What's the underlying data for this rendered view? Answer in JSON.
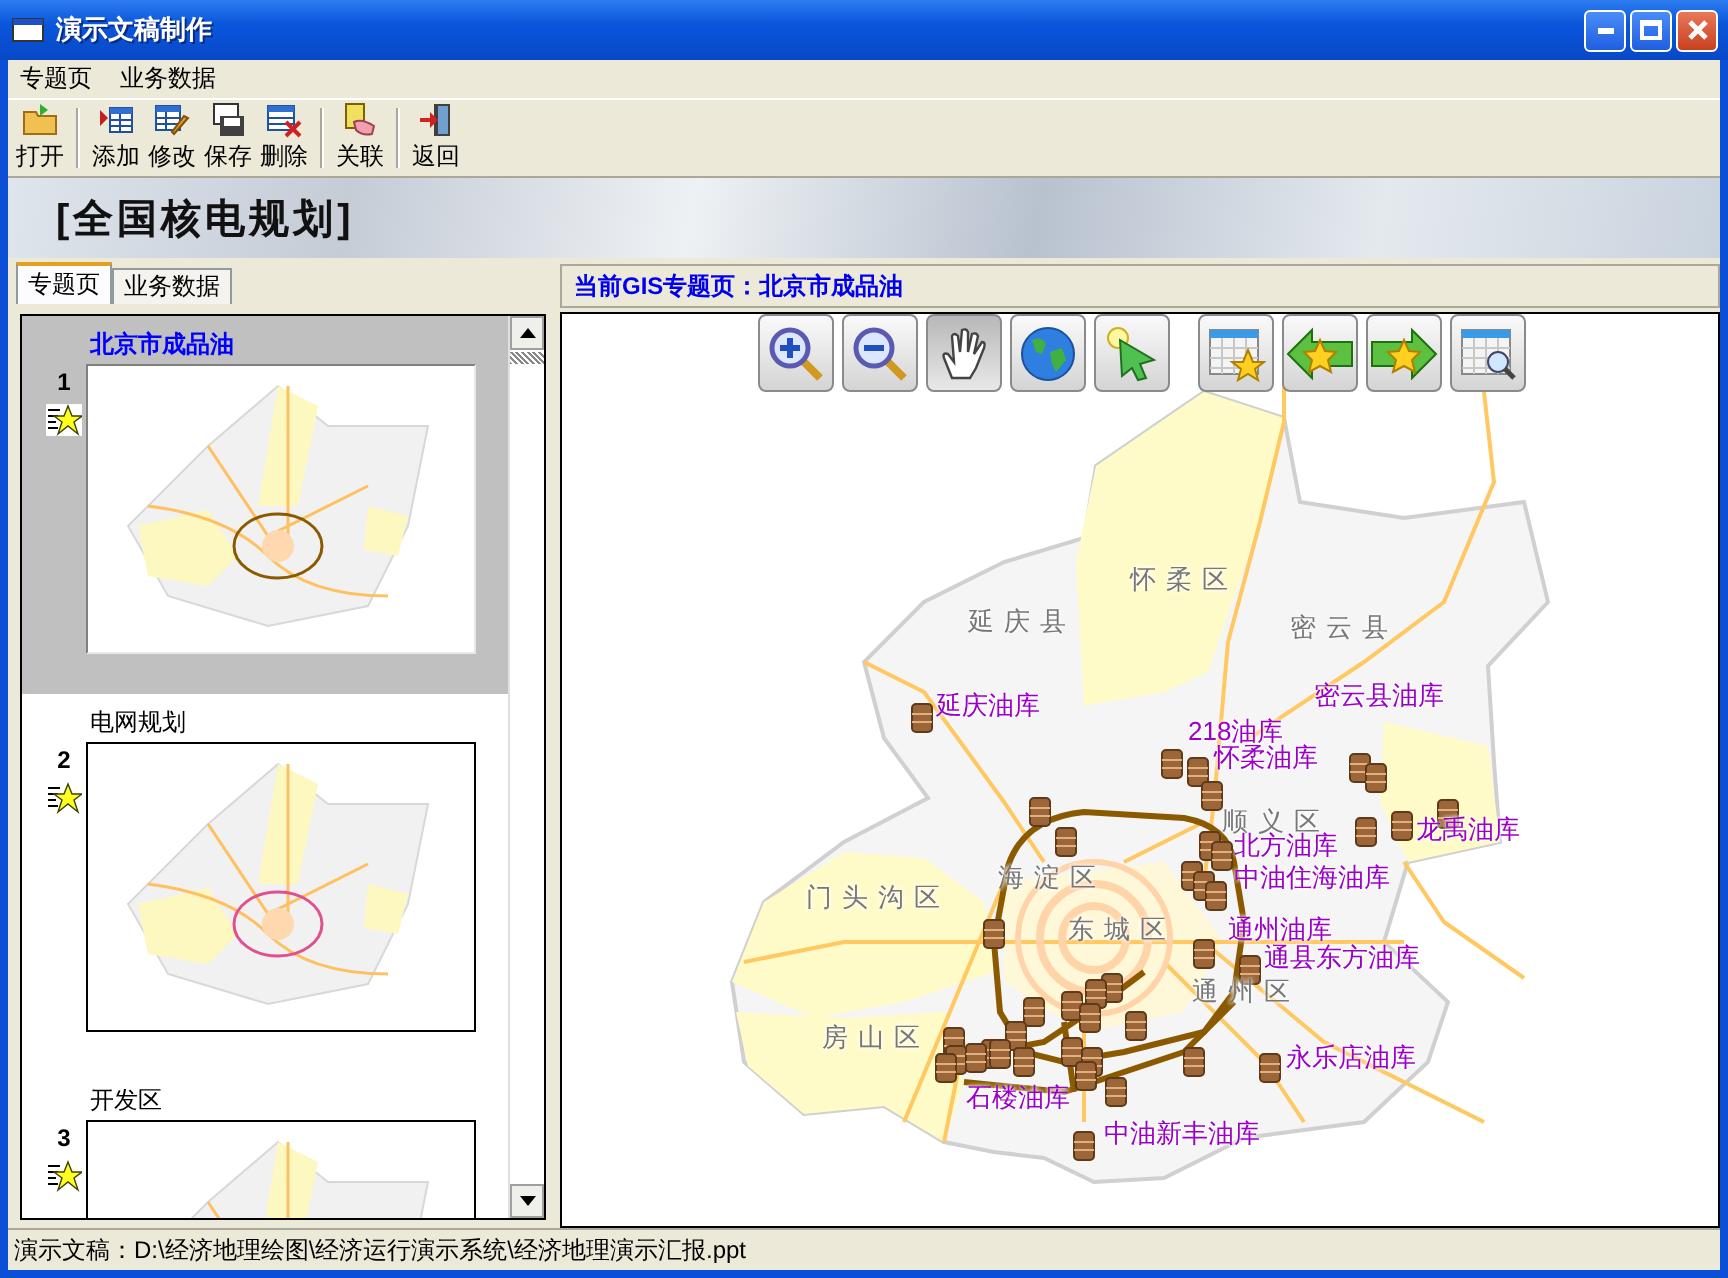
{
  "window": {
    "title": "演示文稿制作"
  },
  "menu": [
    "专题页",
    "业务数据"
  ],
  "toolbar_groups": [
    {
      "buttons": [
        {
          "kind": "open",
          "label": "打开"
        }
      ]
    },
    {
      "buttons": [
        {
          "kind": "add",
          "label": "添加"
        },
        {
          "kind": "edit",
          "label": "修改"
        },
        {
          "kind": "save",
          "label": "保存"
        },
        {
          "kind": "delete",
          "label": "删除"
        }
      ]
    },
    {
      "buttons": [
        {
          "kind": "link",
          "label": "关联"
        }
      ]
    },
    {
      "buttons": [
        {
          "kind": "exit",
          "label": "返回"
        }
      ]
    }
  ],
  "banner": {
    "title": "[全国核电规划]"
  },
  "side_tabs": [
    {
      "label": "专题页",
      "selected": true
    },
    {
      "label": "业务数据",
      "selected": false
    }
  ],
  "slides": [
    {
      "number": "1",
      "title": "北京市成品油",
      "selected": true
    },
    {
      "number": "2",
      "title": "电网规划",
      "selected": false
    },
    {
      "number": "3",
      "title": "开发区",
      "selected": false
    }
  ],
  "gis_header": "当前GIS专题页：北京市成品油",
  "map_tools": [
    {
      "kind": "zoom_in",
      "selected": false
    },
    {
      "kind": "zoom_out",
      "selected": false
    },
    {
      "kind": "pan",
      "selected": true
    },
    {
      "kind": "globe",
      "selected": false
    },
    {
      "kind": "select",
      "selected": false
    },
    {
      "kind": "slide_star",
      "selected": false
    },
    {
      "kind": "prev",
      "selected": false
    },
    {
      "kind": "next",
      "selected": false
    },
    {
      "kind": "grid_search",
      "selected": false
    }
  ],
  "map_labels": [
    {
      "kind": "district",
      "text": "怀柔区"
    },
    {
      "kind": "district",
      "text": "延庆县"
    },
    {
      "kind": "district",
      "text": "密云县"
    },
    {
      "kind": "district",
      "text": "顺义区"
    },
    {
      "kind": "district",
      "text": "门头沟区"
    },
    {
      "kind": "district",
      "text": "海淀区"
    },
    {
      "kind": "district",
      "text": "东城区"
    },
    {
      "kind": "district",
      "text": "通州区"
    },
    {
      "kind": "district",
      "text": "房山区"
    },
    {
      "kind": "depot",
      "text": "延庆油库"
    },
    {
      "kind": "depot",
      "text": "218油库"
    },
    {
      "kind": "depot",
      "text": "怀柔油库"
    },
    {
      "kind": "depot",
      "text": "密云县油库"
    },
    {
      "kind": "depot",
      "text": "龙禹油库"
    },
    {
      "kind": "depot",
      "text": "北方油库"
    },
    {
      "kind": "depot",
      "text": "中油住海油库"
    },
    {
      "kind": "depot",
      "text": "通州油库"
    },
    {
      "kind": "depot",
      "text": "通县东方油库"
    },
    {
      "kind": "depot",
      "text": "永乐店油库"
    },
    {
      "kind": "depot",
      "text": "石楼油库"
    },
    {
      "kind": "depot",
      "text": "中油新丰油库"
    }
  ],
  "status_bar": "演示文稿：D:\\经济地理绘图\\经济运行演示系统\\经济地理演示汇报.ppt"
}
